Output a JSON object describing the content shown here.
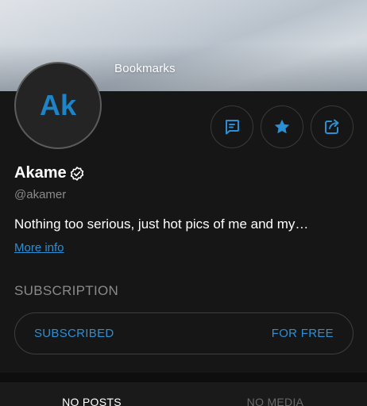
{
  "banner": {
    "title": "Bookmarks"
  },
  "profile": {
    "initials": "Ak",
    "name": "Akame",
    "username": "@akamer",
    "bio": "Nothing too serious, just hot pics of me and my…",
    "more_info": "More info"
  },
  "actions": [
    {
      "icon": "message-icon"
    },
    {
      "icon": "star-icon"
    },
    {
      "icon": "share-icon"
    }
  ],
  "subscription": {
    "section_title": "SUBSCRIPTION",
    "status": "SUBSCRIBED",
    "price": "FOR FREE"
  },
  "tabs": [
    {
      "label": "NO POSTS",
      "active": true
    },
    {
      "label": "NO MEDIA",
      "active": false
    }
  ],
  "colors": {
    "accent": "#2a8fd4",
    "background": "#161616",
    "muted_text": "#8a8a8a"
  }
}
